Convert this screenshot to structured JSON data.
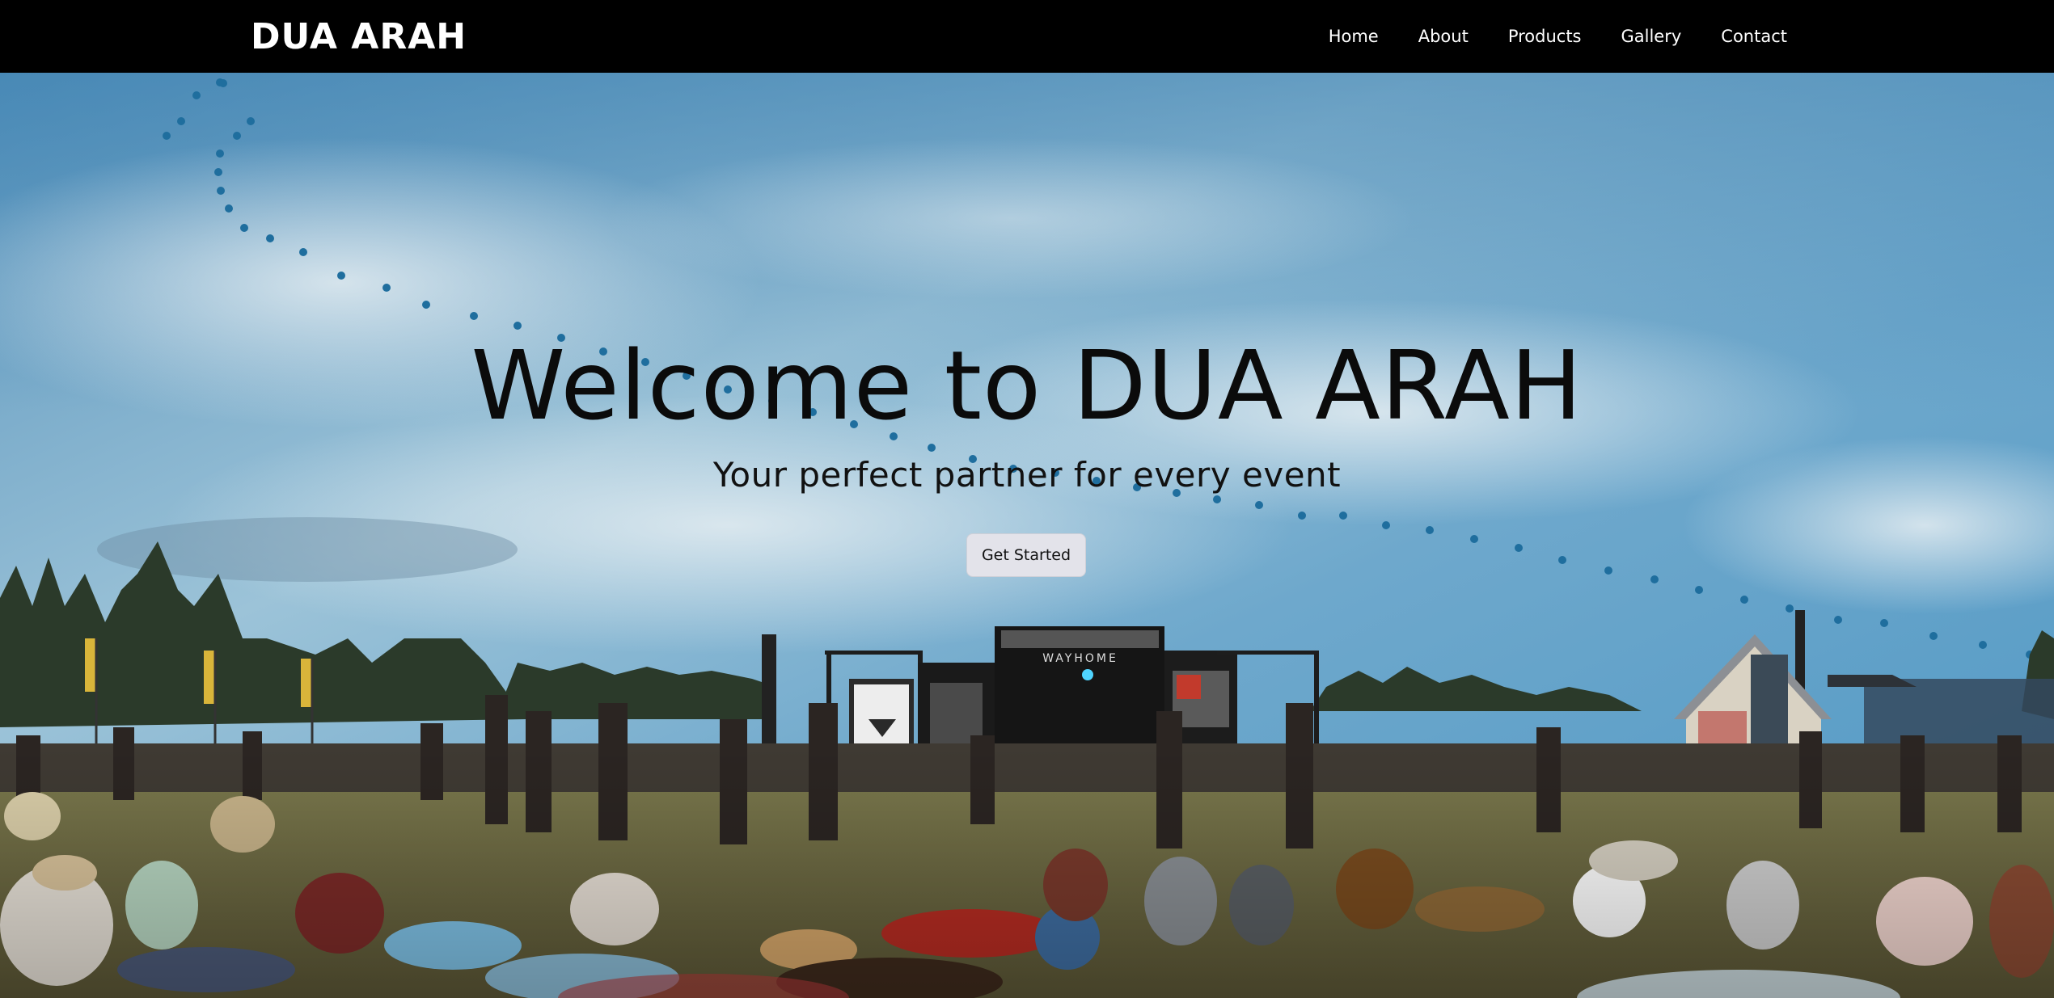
{
  "navbar": {
    "brand": "DUA ARAH",
    "links": [
      {
        "label": "Home"
      },
      {
        "label": "About"
      },
      {
        "label": "Products"
      },
      {
        "label": "Gallery"
      },
      {
        "label": "Contact"
      }
    ]
  },
  "hero": {
    "title": "Welcome to DUA ARAH",
    "subtitle": "Your perfect partner for every event",
    "cta_label": "Get Started",
    "stage_sign": "WAYHOME"
  },
  "colors": {
    "nav_bg": "#000000",
    "sky_top": "#3f86b6",
    "sky_mid": "#8db9d3",
    "grass": "#6b6840",
    "button_bg": "#e3e3ea"
  }
}
